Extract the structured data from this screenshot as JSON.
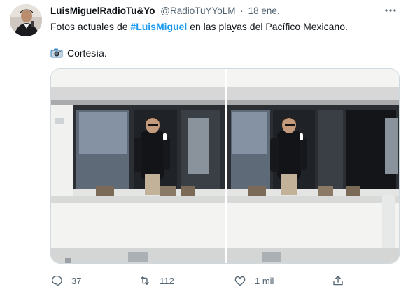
{
  "tweet": {
    "display_name": "LuisMiguelRadioTu&Yo",
    "handle": "@RadioTuYYoLM",
    "separator": "·",
    "date": "18 ene.",
    "text_before": "Fotos actuales de ",
    "hashtag": "#LuisMiguel",
    "text_after": " en las playas del Pacífico Mexicano.",
    "courtesy_text": "Cortesía.",
    "icons": {
      "more": "more-dots-icon",
      "camera": "camera-icon",
      "reply": "reply-icon",
      "retweet": "retweet-icon",
      "like": "like-icon",
      "share": "share-icon"
    },
    "accent_color": "#1d9bf0"
  },
  "actions": {
    "reply_count": "37",
    "retweet_count": "112",
    "like_count": "1 mil"
  }
}
